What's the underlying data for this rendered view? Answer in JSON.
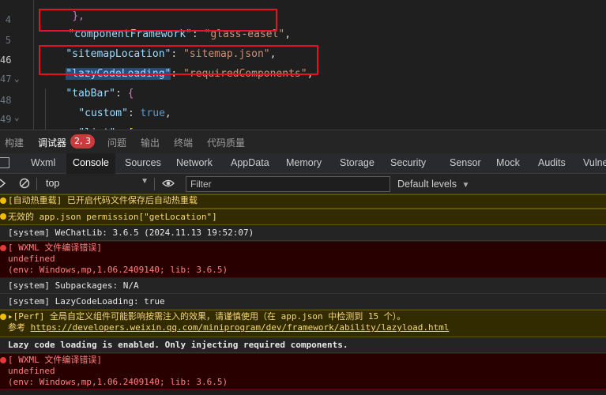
{
  "editor": {
    "gutter": [
      "4",
      "5",
      "46",
      "47",
      "48",
      "49"
    ],
    "lines": [
      {
        "text": "},"
      },
      {
        "key": "\"componentFramework\"",
        "sep": ": ",
        "value": "\"glass-easel\"",
        "tail": ","
      },
      {
        "key": "\"sitemapLocation\"",
        "sep": ": ",
        "value": "\"sitemap.json\"",
        "tail": ","
      },
      {
        "key": "\"lazyCodeLoading\"",
        "sep": ": ",
        "value": "\"requiredComponents\"",
        "tail": ","
      },
      {
        "key": "\"tabBar\"",
        "sep": ": ",
        "value": "{",
        "tail": ""
      },
      {
        "key": "\"custom\"",
        "sep": ": ",
        "value": "true",
        "tail": ","
      },
      {
        "key": "\"list\"",
        "sep": ": ",
        "value": "[",
        "tail": ""
      }
    ]
  },
  "panel_tabs": {
    "build": "构建",
    "debugger": "调试器",
    "badge": "2, 3",
    "issues": "问题",
    "output": "输出",
    "terminal": "终端",
    "code_quality": "代码质量"
  },
  "dev_tabs": [
    "Wxml",
    "Console",
    "Sources",
    "Network",
    "AppData",
    "Memory",
    "Storage",
    "Security",
    "Sensor",
    "Mock",
    "Audits",
    "Vulne"
  ],
  "console_toolbar": {
    "context": "top",
    "filter_placeholder": "Filter",
    "levels": "Default levels"
  },
  "messages": {
    "m1": "[自动热重载] 已开启代码文件保存后自动热重载",
    "m2": "无效的 app.json permission[\"getLocation\"]",
    "m3": "[system] WeChatLib: 3.6.5 (2024.11.13 19:52:07)",
    "m4_title": "[ WXML 文件编译错误]",
    "m4_undef": "undefined",
    "m4_env": "(env: Windows,mp,1.06.2409140; lib: 3.6.5)",
    "m5": "[system] Subpackages: N/A",
    "m6": "[system] LazyCodeLoading: true",
    "m7_line1": "▸[Perf] 全局自定义组件可能影响按需注入的效果，请谨慎使用（在 app.json 中检测到 15 个）。",
    "m7_ref": "参考 ",
    "m7_link": "https://developers.weixin.qq.com/miniprogram/dev/framework/ability/lazyload.html",
    "m8": "Lazy code loading is enabled. Only injecting required components.",
    "m9_title": "[ WXML 文件编译错误]",
    "m9_undef": "undefined",
    "m9_env": "(env: Windows,mp,1.06.2409140; lib: 3.6.5)"
  },
  "colors": {
    "warn_bg": "#332b00",
    "error_bg": "#290000",
    "highlight_box": "#e81123"
  }
}
